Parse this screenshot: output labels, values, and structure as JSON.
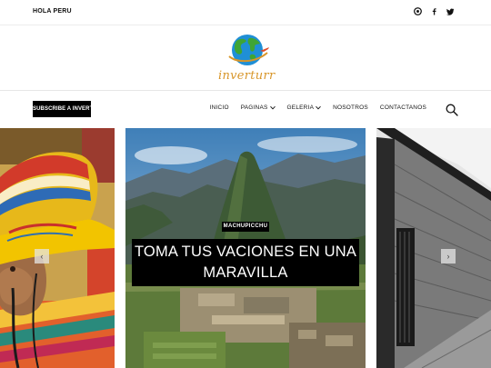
{
  "topbar": {
    "greeting": "HOLA PERU",
    "social": [
      {
        "icon": "instagram-icon"
      },
      {
        "icon": "facebook-icon"
      },
      {
        "icon": "twitter-icon"
      }
    ]
  },
  "logo": {
    "text": "inverturr",
    "colors": {
      "globe_blue": "#1f8fd6",
      "globe_green": "#3fa535",
      "text_orange": "#d8962a"
    }
  },
  "nav": {
    "subscribe_label": "SUBSCRIBE A INVERTURR",
    "items": [
      {
        "label": "INICIO",
        "has_dropdown": false
      },
      {
        "label": "PAGINAS",
        "has_dropdown": true
      },
      {
        "label": "GELERIA",
        "has_dropdown": true
      },
      {
        "label": "NOSOTROS",
        "has_dropdown": false
      },
      {
        "label": "CONTACTANOS",
        "has_dropdown": false
      }
    ],
    "search_icon": "search-icon"
  },
  "slider": {
    "featured": {
      "category": "MACHUPICCHU",
      "title": "TOMA TUS VACIONES EN UNA MARAVILLA"
    },
    "prev_icon": "chevron-left-icon",
    "next_icon": "chevron-right-icon",
    "prev_label": "‹",
    "next_label": "›"
  }
}
